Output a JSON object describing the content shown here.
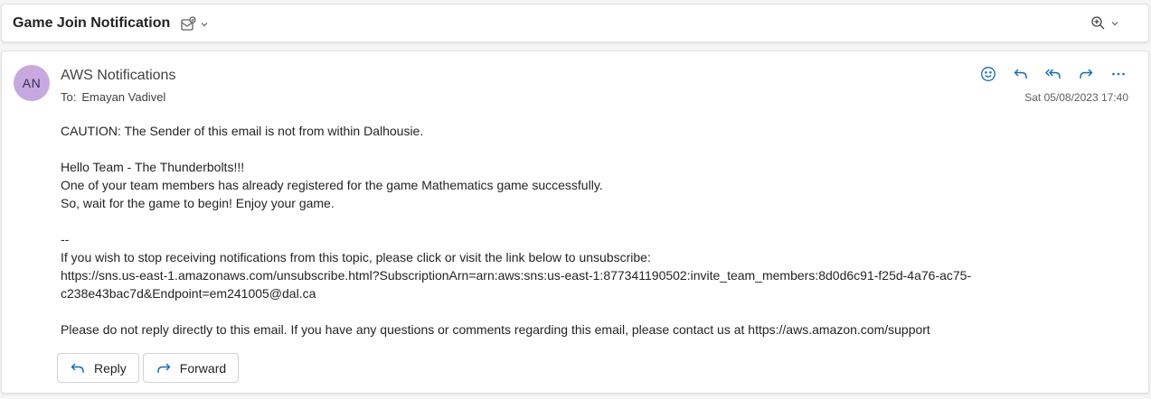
{
  "header": {
    "subject": "Game Join Notification"
  },
  "message": {
    "avatar_initials": "AN",
    "sender": "AWS Notifications",
    "to_label": "To:",
    "to_value": "Emayan Vadivel",
    "timestamp": "Sat 05/08/2023 17:40",
    "body": {
      "caution": "CAUTION: The Sender of this email is not from within Dalhousie.",
      "greeting": "Hello Team - The Thunderbolts!!!",
      "line1": "One of your team members has already registered for the game Mathematics game successfully.",
      "line2": "So, wait for the game to begin! Enjoy your game.",
      "separator": "--",
      "unsub_intro": "If you wish to stop receiving notifications from this topic, please click or visit the link below to unsubscribe:",
      "unsub_link_1": "https://sns.us-east-1.amazonaws.com/unsubscribe.html?SubscriptionArn=arn:aws:sns:us-east-1:877341190502:invite_team_members:8d0d6c91-f25d-4a76-ac75-",
      "unsub_link_2": "c238e43bac7d&Endpoint=em241005@dal.ca",
      "footer_text": "Please do not reply directly to this email. If you have any questions or comments regarding this email, please contact us at ",
      "footer_link": "https://aws.amazon.com/support"
    }
  },
  "buttons": {
    "reply": "Reply",
    "forward": "Forward"
  },
  "colors": {
    "accent": "#0f6cbd",
    "avatar_bg": "#c8a9df"
  },
  "icons": [
    "summary-icon",
    "chevron-down-icon",
    "zoom-icon",
    "emoji-icon",
    "reply-icon",
    "reply-all-icon",
    "forward-icon",
    "more-icon"
  ]
}
